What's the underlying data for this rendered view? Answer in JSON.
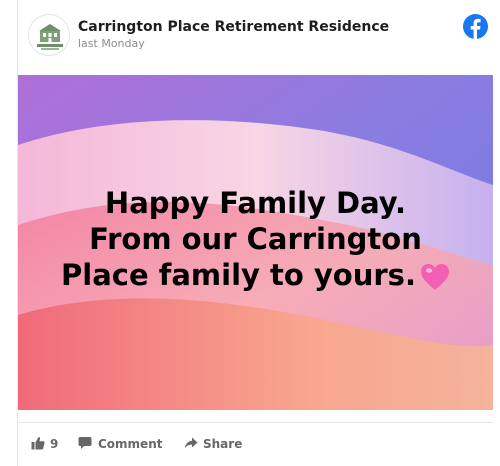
{
  "post": {
    "page_name": "Carrington Place Retirement Residence",
    "timestamp": "last Monday",
    "image_text": {
      "line1": "Happy Family Day.",
      "line2": "From our Carrington",
      "line3": "Place family to yours."
    },
    "heart_emoji": "pink-heart-icon"
  },
  "header": {
    "platform_icon": "facebook-icon",
    "platform_color": "#1877f2"
  },
  "actions": {
    "like_count": "9",
    "comment_label": "Comment",
    "share_label": "Share"
  },
  "colors": {
    "text_primary": "#1c1e21",
    "text_secondary": "#65676b",
    "heart": "#f35fb4"
  }
}
